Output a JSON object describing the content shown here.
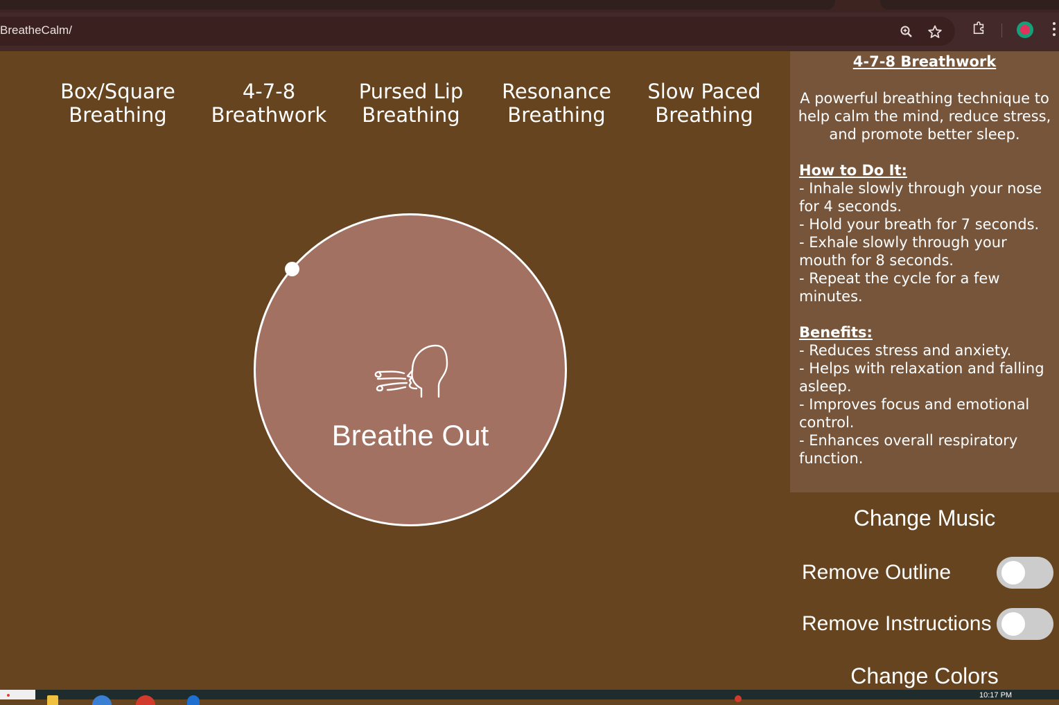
{
  "browser": {
    "url": "BreatheCalm/",
    "icons": [
      "zoom-icon",
      "star-icon",
      "extensions-icon",
      "profile-icon",
      "menu-icon"
    ]
  },
  "techniques": [
    {
      "label": "Box/Square\nBreathing"
    },
    {
      "label": "4-7-8\nBreathwork"
    },
    {
      "label": "Pursed Lip\nBreathing"
    },
    {
      "label": "Resonance\nBreathing"
    },
    {
      "label": "Slow Paced\nBreathing"
    }
  ],
  "exercise": {
    "phase_label": "Breathe Out",
    "icon": "exhale-icon",
    "circle_color": "#a27162"
  },
  "instructions": {
    "title": "4-7-8 Breathwork",
    "description": "A powerful breathing technique to help calm the mind, reduce stress, and promote better sleep.",
    "how_title": "How to Do It:",
    "how_steps": [
      "- Inhale slowly through your nose for 4 seconds.",
      "- Hold your breath for 7 seconds.",
      "- Exhale slowly through your mouth for 8 seconds.",
      "- Repeat the cycle for a few minutes."
    ],
    "benefits_title": "Benefits:",
    "benefits": [
      "- Reduces stress and anxiety.",
      "- Helps with relaxation and falling asleep.",
      "- Improves focus and emotional control.",
      "- Enhances overall respiratory function."
    ]
  },
  "settings": {
    "change_music": "Change Music",
    "remove_outline": "Remove Outline",
    "remove_outline_on": false,
    "remove_instructions": "Remove Instructions",
    "remove_instructions_on": false,
    "change_colors": "Change Colors"
  },
  "taskbar": {
    "clock": "10:17 PM"
  },
  "colors": {
    "background": "#66441f",
    "panel": "#76553a",
    "toggle_off": "#cccccc"
  }
}
